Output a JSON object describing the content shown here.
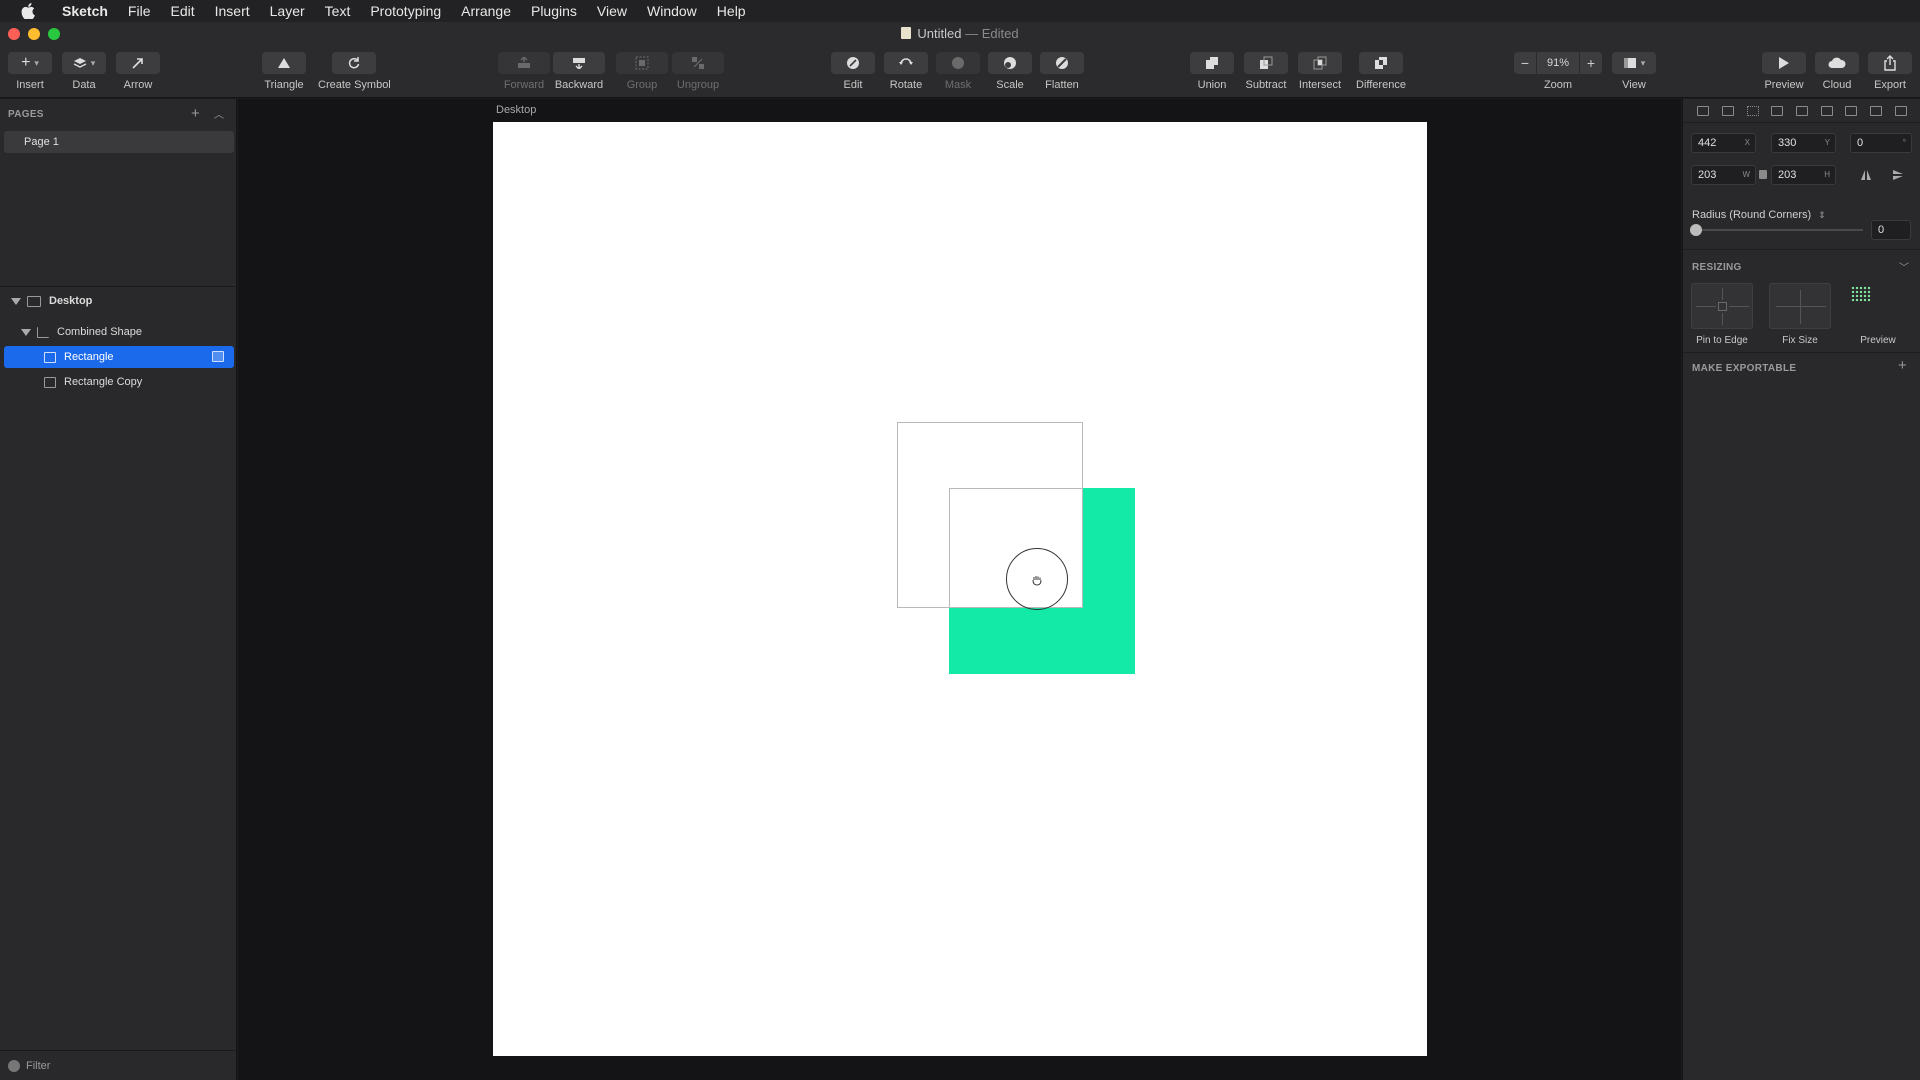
{
  "menubar": {
    "app": "Sketch",
    "items": [
      "File",
      "Edit",
      "Insert",
      "Layer",
      "Text",
      "Prototyping",
      "Arrange",
      "Plugins",
      "View",
      "Window",
      "Help"
    ]
  },
  "window": {
    "title": "Untitled",
    "edited": "— Edited"
  },
  "toolbar": {
    "insert": "Insert",
    "data": "Data",
    "arrow": "Arrow",
    "triangle": "Triangle",
    "create_symbol": "Create Symbol",
    "forward": "Forward",
    "backward": "Backward",
    "group": "Group",
    "ungroup": "Ungroup",
    "edit": "Edit",
    "rotate": "Rotate",
    "mask": "Mask",
    "scale": "Scale",
    "flatten": "Flatten",
    "union": "Union",
    "subtract": "Subtract",
    "intersect": "Intersect",
    "difference": "Difference",
    "zoom_value": "91%",
    "zoom": "Zoom",
    "view": "View",
    "preview": "Preview",
    "cloud": "Cloud",
    "export": "Export"
  },
  "sidebar": {
    "pages_header": "PAGES",
    "pages": [
      "Page 1"
    ],
    "layers": {
      "artboard": "Desktop",
      "group": "Combined Shape",
      "items": [
        "Rectangle",
        "Rectangle Copy"
      ]
    },
    "filter": "Filter"
  },
  "canvas": {
    "artboard_label": "Desktop",
    "accent_color": "#14eaa8"
  },
  "inspector": {
    "x": "442",
    "x_label": "X",
    "y": "330",
    "y_label": "Y",
    "rotation": "0",
    "rotation_label": "°",
    "w": "203",
    "w_label": "W",
    "h": "203",
    "h_label": "H",
    "radius_label": "Radius (Round Corners)",
    "radius_value": "0",
    "resizing_header": "RESIZING",
    "pin_to_edge": "Pin to Edge",
    "fix_size": "Fix Size",
    "preview": "Preview",
    "exportable_header": "MAKE EXPORTABLE"
  }
}
